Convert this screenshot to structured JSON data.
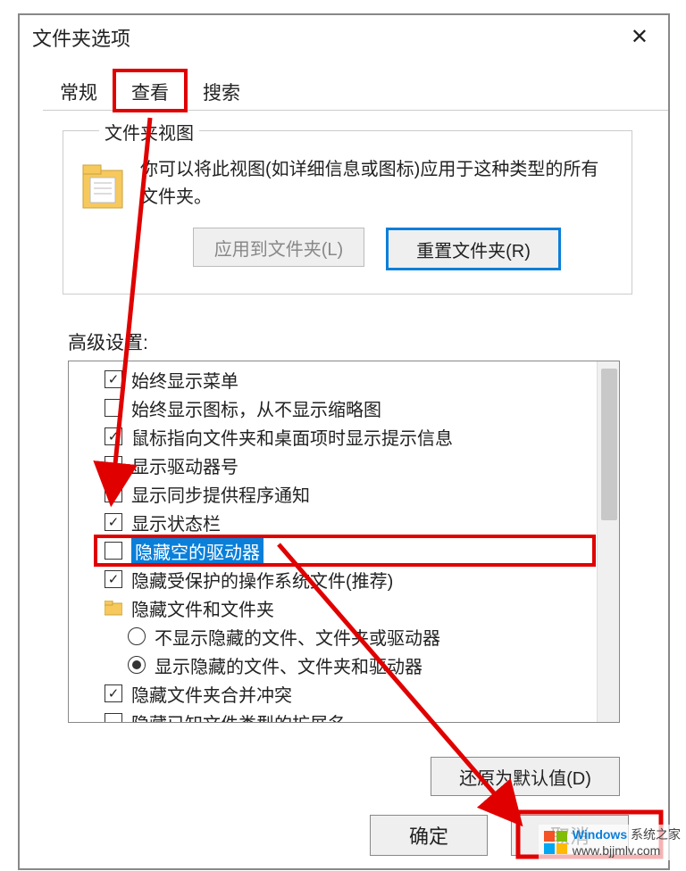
{
  "dialog": {
    "title": "文件夹选项",
    "tabs": [
      "常规",
      "查看",
      "搜索"
    ],
    "active_tab": 1
  },
  "folder_view": {
    "legend": "文件夹视图",
    "description": "你可以将此视图(如详细信息或图标)应用于这种类型的所有文件夹。",
    "apply_button": "应用到文件夹(L)",
    "reset_button": "重置文件夹(R)"
  },
  "advanced": {
    "label": "高级设置:",
    "items": [
      {
        "type": "checkbox",
        "checked": true,
        "indent": 0,
        "text": "始终显示菜单"
      },
      {
        "type": "checkbox",
        "checked": false,
        "indent": 0,
        "text": "始终显示图标，从不显示缩略图"
      },
      {
        "type": "checkbox",
        "checked": true,
        "indent": 0,
        "text": "鼠标指向文件夹和桌面项时显示提示信息"
      },
      {
        "type": "checkbox",
        "checked": false,
        "indent": 0,
        "text": "显示驱动器号"
      },
      {
        "type": "checkbox",
        "checked": false,
        "indent": 0,
        "text": "显示同步提供程序通知"
      },
      {
        "type": "checkbox",
        "checked": true,
        "indent": 0,
        "text": "显示状态栏"
      },
      {
        "type": "checkbox",
        "checked": false,
        "indent": 0,
        "text": "隐藏空的驱动器",
        "selected": true,
        "highlight": true
      },
      {
        "type": "checkbox",
        "checked": true,
        "indent": 0,
        "text": "隐藏受保护的操作系统文件(推荐)"
      },
      {
        "type": "folder",
        "indent": 0,
        "text": "隐藏文件和文件夹"
      },
      {
        "type": "radio",
        "checked": false,
        "indent": 1,
        "text": "不显示隐藏的文件、文件夹或驱动器"
      },
      {
        "type": "radio",
        "checked": true,
        "indent": 1,
        "text": "显示隐藏的文件、文件夹和驱动器"
      },
      {
        "type": "checkbox",
        "checked": true,
        "indent": 0,
        "text": "隐藏文件夹合并冲突"
      },
      {
        "type": "checkbox",
        "checked": false,
        "indent": 0,
        "text": "隐藏已知文件类型的扩展名"
      }
    ]
  },
  "buttons": {
    "restore_defaults": "还原为默认值(D)",
    "ok": "确定",
    "cancel": "取消"
  },
  "watermark": {
    "brand": "Windows",
    "suffix": "系统之家",
    "url": "www.bjjmlv.com"
  }
}
